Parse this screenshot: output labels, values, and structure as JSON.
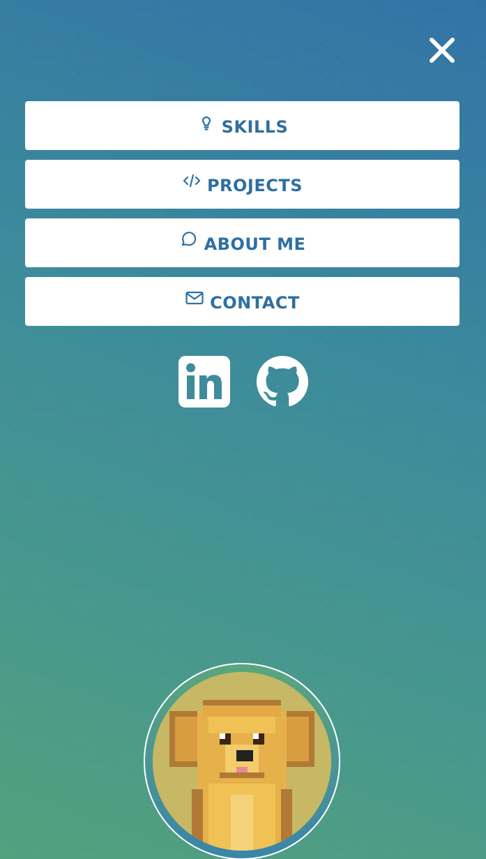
{
  "menu": {
    "items": [
      {
        "label": "SKILLS",
        "icon": "lightbulb-icon"
      },
      {
        "label": "PROJECTS",
        "icon": "code-icon"
      },
      {
        "label": "ABOUT ME",
        "icon": "chat-bubble-icon"
      },
      {
        "label": "CONTACT",
        "icon": "envelope-icon"
      }
    ]
  },
  "close": {
    "icon": "close-icon"
  },
  "socials": [
    {
      "icon": "linkedin-icon"
    },
    {
      "icon": "github-icon"
    }
  ],
  "avatar": {
    "icon": "pixel-dog-avatar"
  },
  "colors": {
    "accent": "#2f6fa1",
    "gradient_top": "#3273a6",
    "gradient_bottom": "#52a17d",
    "button_bg": "#ffffff"
  }
}
